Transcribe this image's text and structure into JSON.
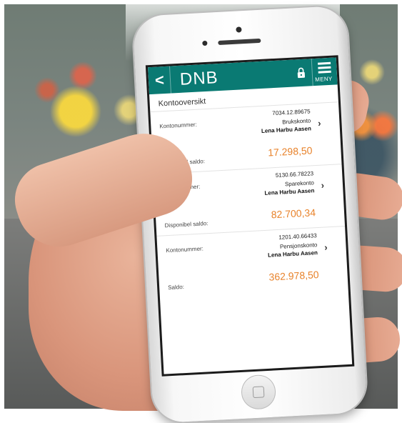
{
  "app": {
    "logo": "DNB",
    "back_glyph": "<",
    "menu_label": "MENY"
  },
  "page": {
    "title": "Kontooversikt"
  },
  "accounts": [
    {
      "number_label": "Kontonummer:",
      "number": "7034.12.89675",
      "type": "Brukskonto",
      "owner": "Lena Harbu Aasen",
      "balance_label": "Disponibel saldo:",
      "balance": "17.298,50"
    },
    {
      "number_label": "Kontonummer:",
      "number": "5130.66.78223",
      "type": "Sparekonto",
      "owner": "Lena Harbu Aasen",
      "balance_label": "Disponibel saldo:",
      "balance": "82.700,34"
    },
    {
      "number_label": "Kontonummer:",
      "number": "1201.40.66433",
      "type": "Pensjonskonto",
      "owner": "Lena Harbu Aasen",
      "balance_label": "Saldo:",
      "balance": "362.978,50"
    }
  ],
  "colors": {
    "brand": "#0a7a73",
    "balance": "#e8822a"
  },
  "icons": [
    "back-icon",
    "lock-icon",
    "menu-icon",
    "chevron-right-icon"
  ]
}
